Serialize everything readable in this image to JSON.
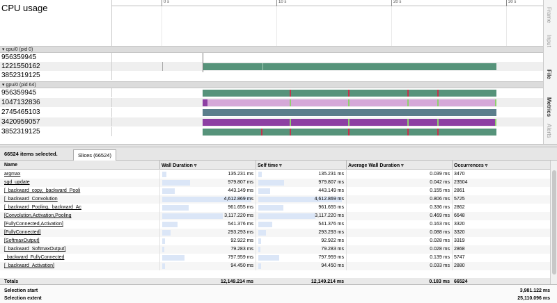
{
  "timeline": {
    "cpu_title": "CPU usage",
    "ticks": [
      "0 s",
      "10 s",
      "20 s",
      "30 s"
    ],
    "cpu_group": {
      "label": "▾ cpu/0 (pid 0)",
      "tracks": [
        "956359945",
        "1221550162",
        "3852319125"
      ]
    },
    "gpu_group": {
      "label": "▾ gpu/0 (pid 64)",
      "tracks": [
        "956359945",
        "1047132836",
        "2745465103",
        "3420959057",
        "3852319125"
      ]
    },
    "colors": {
      "green": "#56937a",
      "pink": "#d5a8d8",
      "slate": "#5b7e8c",
      "purple": "#8d3fa3",
      "red_mark": "#c2344d",
      "light_green_mark": "#8fcf6e"
    }
  },
  "side_tabs": [
    "Frame",
    "Input",
    "File",
    "Metrics",
    "Alerts"
  ],
  "panel": {
    "selected_count": "66524 items selected.",
    "tab": "Slices (66524)",
    "columns": [
      "Name",
      "Wall Duration",
      "Self time",
      "Average Wall Duration",
      "Occurrences"
    ],
    "sort_arrow": "▿",
    "rows": [
      {
        "name": "argmax",
        "wall": "135.231 ms",
        "self": "135.231 ms",
        "avg": "0.039 ms",
        "occ": "3470",
        "frac": 0.043
      },
      {
        "name": "sgd_update",
        "wall": "979.807 ms",
        "self": "979.807 ms",
        "avg": "0.042 ms",
        "occ": "23504",
        "frac": 0.31
      },
      {
        "name": "[_backward_copy,_backward_Pooli",
        "wall": "443.149 ms",
        "self": "443.149 ms",
        "avg": "0.155 ms",
        "occ": "2861",
        "frac": 0.14
      },
      {
        "name": "[_backward_Convolution",
        "wall": "4,612.869 ms",
        "self": "4,612.869 ms",
        "avg": "0.806 ms",
        "occ": "5725",
        "frac": 1.0
      },
      {
        "name": "[_backward_Pooling,_backward_Ac",
        "wall": "961.655 ms",
        "self": "961.655 ms",
        "avg": "0.336 ms",
        "occ": "2862",
        "frac": 0.3
      },
      {
        "name": "[Convolution,Activation,Pooling",
        "wall": "3,117.220 ms",
        "self": "3,117.220 ms",
        "avg": "0.469 ms",
        "occ": "6648",
        "frac": 0.68
      },
      {
        "name": "[FullyConnected,Activation]",
        "wall": "541.376 ms",
        "self": "541.376 ms",
        "avg": "0.163 ms",
        "occ": "3320",
        "frac": 0.17
      },
      {
        "name": "[FullyConnected]",
        "wall": "293.293 ms",
        "self": "293.293 ms",
        "avg": "0.088 ms",
        "occ": "3320",
        "frac": 0.09
      },
      {
        "name": "[SoftmaxOutput]",
        "wall": "92.922 ms",
        "self": "92.922 ms",
        "avg": "0.028 ms",
        "occ": "3319",
        "frac": 0.03
      },
      {
        "name": "[_backward_SoftmaxOutput]",
        "wall": "79.283 ms",
        "self": "79.283 ms",
        "avg": "0.028 ms",
        "occ": "2868",
        "frac": 0.025
      },
      {
        "name": "_backward_FullyConnected",
        "wall": "797.959 ms",
        "self": "797.959 ms",
        "avg": "0.139 ms",
        "occ": "5747",
        "frac": 0.25
      },
      {
        "name": "[_backward_Activation]",
        "wall": "94.450 ms",
        "self": "94.450 ms",
        "avg": "0.033 ms",
        "occ": "2880",
        "frac": 0.03
      }
    ],
    "totals": {
      "name": "Totals",
      "wall": "12,149.214 ms",
      "self": "12,149.214 ms",
      "avg": "0.183 ms",
      "occ": "66524"
    }
  },
  "summary": {
    "start_label": "Selection start",
    "start_value": "3,981.122 ms",
    "extent_label": "Selection extent",
    "extent_value": "25,110.096 ms"
  }
}
